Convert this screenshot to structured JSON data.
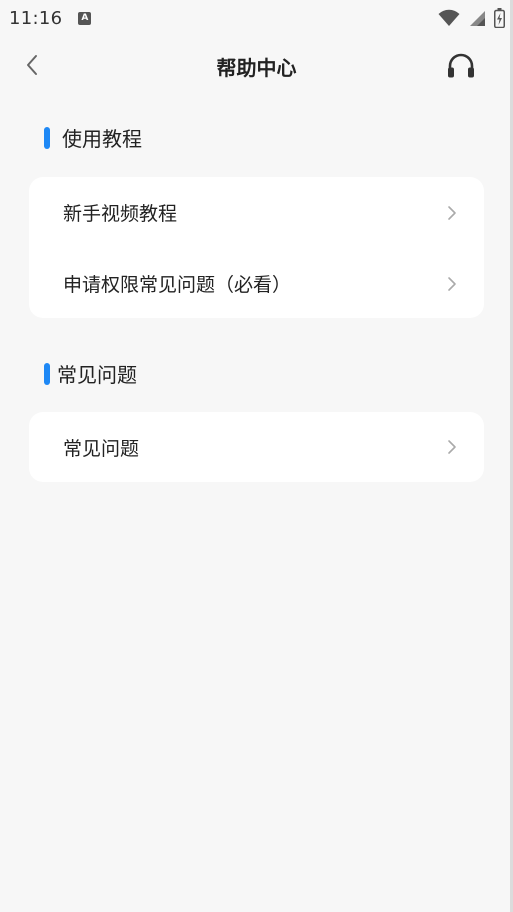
{
  "status_bar": {
    "time": "11:16",
    "notification_glyph": "A",
    "icons": [
      "wifi-icon",
      "signal-icon",
      "battery-icon"
    ]
  },
  "header": {
    "title": "帮助中心",
    "back_icon": "chevron-left-icon",
    "support_icon": "headphones-icon"
  },
  "sections": [
    {
      "title": "使用教程",
      "items": [
        {
          "label": "新手视频教程"
        },
        {
          "label": "申请权限常见问题（必看）"
        }
      ]
    },
    {
      "title": "常见问题",
      "items": [
        {
          "label": "常见问题"
        }
      ]
    }
  ],
  "colors": {
    "accent": "#1e88f5",
    "background": "#f7f7f7",
    "card": "#ffffff"
  }
}
